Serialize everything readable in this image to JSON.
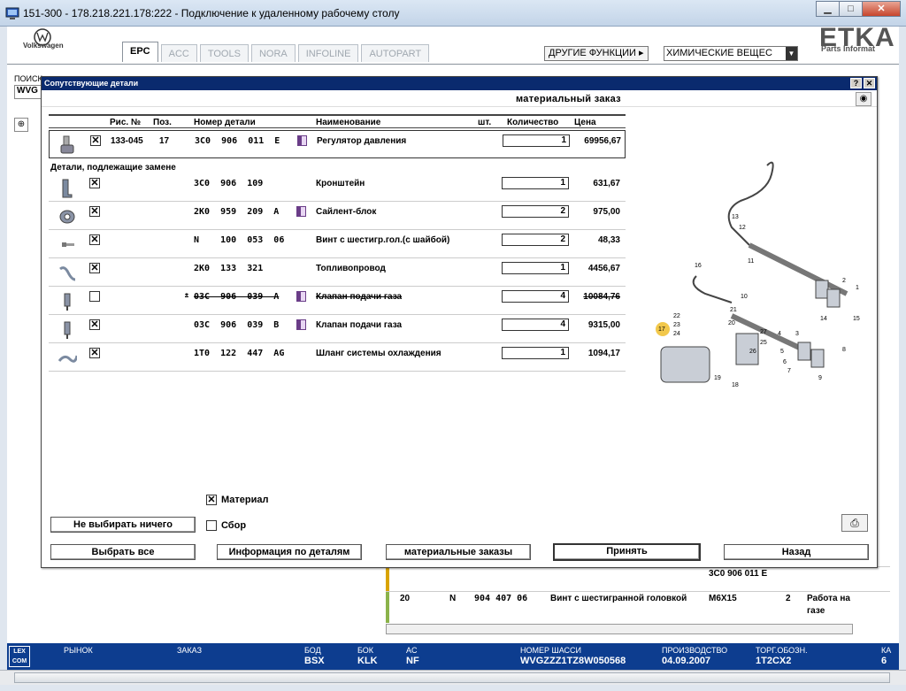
{
  "window": {
    "title": "151-300 - 178.218.221.178:222 - Подключение к удаленному рабочему столу"
  },
  "etka": {
    "brand": "Volkswagen",
    "logo": "ETKA",
    "logo_sub": "Parts Informat",
    "tabs": [
      "EPC",
      "ACC",
      "TOOLS",
      "NORA",
      "INFOLINE",
      "AUTOPART"
    ],
    "active_tab": "EPC",
    "other_functions": "ДРУГИЕ ФУНКЦИИ ▸",
    "chem_select": "ХИМИЧЕСКИЕ ВЕЩЕС",
    "search_label": "ПОИСК",
    "search_value": "WVG"
  },
  "background_rows": {
    "row1_code": "3C0 906 011 E",
    "row2": {
      "pos": "20",
      "n": "N",
      "part": "904 407 06",
      "name": "Винт с шестигранной головкой",
      "spec": "M6X15",
      "qty": "2",
      "note1": "Работа на",
      "note2": "газе"
    }
  },
  "statusbar": {
    "market_label": "РЫНОК",
    "order_label": "ЗАКАЗ",
    "bod_label": "БОД",
    "bod_value": "BSX",
    "bok_label": "БОК",
    "bok_value": "KLK",
    "ac_label": "AC",
    "ac_value": "NF",
    "chassis_label": "НОМЕР ШАССИ",
    "chassis_value": "WVGZZZ1TZ8W050568",
    "prod_label": "ПРОИЗВОДСТВО",
    "prod_value": "04.09.2007",
    "trade_label": "ТОРГ.ОБОЗН.",
    "trade_value": "1T2CX2",
    "extra_label": "КА",
    "extra_value": "6",
    "lexcom": "LEX COM"
  },
  "dialog": {
    "title": "Сопутствующие детали",
    "subtitle": "материальный заказ",
    "columns": {
      "fig": "Рис. №",
      "pos": "Поз.",
      "part": "Номер детали",
      "name": "Наименование",
      "unit": "шт.",
      "qty": "Количество",
      "price": "Цена"
    },
    "main_item": {
      "fig": "133-045",
      "pos": "17",
      "part": "3C0  906  011  E",
      "name": "Регулятор давления",
      "qty": "1",
      "price": "69956,67",
      "checked": true
    },
    "section_label": "Детали, подлежащие замене",
    "items": [
      {
        "part": "3C0  906  109",
        "name": "Кронштейн",
        "qty": "1",
        "price": "631,67",
        "checked": true,
        "doc": false,
        "struck": false
      },
      {
        "part": "2K0  959  209  A",
        "name": "Сайлент-блок",
        "qty": "2",
        "price": "975,00",
        "checked": true,
        "doc": true,
        "struck": false
      },
      {
        "part": "N    100  053  06",
        "name": "Винт с шестигр.гол.(с шайбой)",
        "qty": "2",
        "price": "48,33",
        "checked": true,
        "doc": false,
        "struck": false
      },
      {
        "part": "2K0  133  321",
        "name": "Топливопровод",
        "qty": "1",
        "price": "4456,67",
        "checked": true,
        "doc": false,
        "struck": false
      },
      {
        "part": "03C  906  039  A",
        "name": "Клапан подачи газа",
        "qty": "4",
        "price": "10084,76",
        "checked": false,
        "doc": true,
        "struck": true,
        "star": "*"
      },
      {
        "part": "03C  906  039  B",
        "name": "Клапан подачи газа",
        "qty": "4",
        "price": "9315,00",
        "checked": true,
        "doc": true,
        "struck": false
      },
      {
        "part": "1T0  122  447  AG",
        "name": "Шланг системы охлаждения",
        "qty": "1",
        "price": "1094,17",
        "checked": true,
        "doc": false,
        "struck": false
      }
    ],
    "material_label": "Материал",
    "material_checked": true,
    "assembly_label": "Сбор",
    "assembly_checked": false,
    "buttons": {
      "select_none": "Не выбирать ничего",
      "select_all": "Выбрать все",
      "part_info": "Информация по деталям",
      "material_orders": "материальные заказы",
      "accept": "Принять",
      "back": "Назад"
    },
    "diagram_labels": [
      "13",
      "12",
      "11",
      "16",
      "1",
      "2",
      "15",
      "14",
      "10",
      "21",
      "20",
      "22",
      "23",
      "24",
      "17",
      "27",
      "25",
      "26",
      "19",
      "18",
      "3",
      "4",
      "5",
      "6",
      "7",
      "8",
      "9"
    ]
  },
  "colors": {
    "title_bar": "#0a2a6e",
    "status_bar": "#0d3d8f",
    "close_button": "#c7452c",
    "highlight_marker": "#f2c84b"
  }
}
